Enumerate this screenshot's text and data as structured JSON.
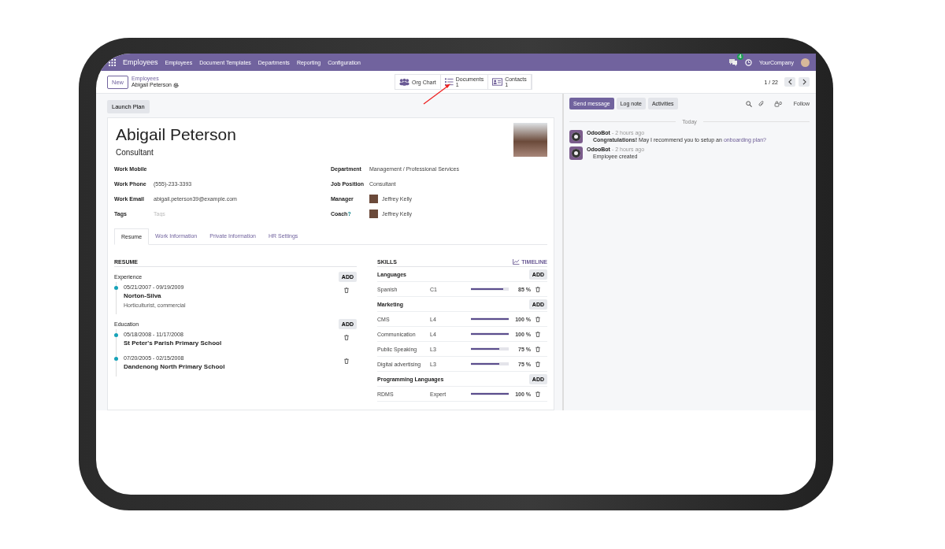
{
  "navbar": {
    "app": "Employees",
    "menu": [
      "Employees",
      "Document Templates",
      "Departments",
      "Reporting",
      "Configuration"
    ],
    "message_count": "4",
    "company": "YourCompany"
  },
  "control_panel": {
    "new": "New",
    "breadcrumb": "Employees",
    "record": "Abigail Peterson",
    "smart_buttons": [
      {
        "kind": "org",
        "label": "Org Chart"
      },
      {
        "kind": "docs",
        "label": "Documents",
        "count": "1"
      },
      {
        "kind": "contacts",
        "label": "Contacts",
        "count": "1"
      }
    ],
    "pager": "1 / 22"
  },
  "launch_plan": "Launch Plan",
  "employee": {
    "name": "Abigail Peterson",
    "job_title": "Consultant"
  },
  "left_fields": [
    {
      "label": "Work Mobile"
    },
    {
      "label": "Work Phone",
      "value": "(555)-233-3393"
    },
    {
      "label": "Work Email",
      "value": "abigail.peterson39@example.com"
    },
    {
      "label": "Tags",
      "placeholder": "Tags"
    }
  ],
  "right_fields": [
    {
      "label": "Department",
      "value": "Management / Professional Services"
    },
    {
      "label": "Job Position",
      "value": "Consultant"
    },
    {
      "label": "Manager",
      "value": "Jeffrey Kelly",
      "avatar": true
    },
    {
      "label": "Coach",
      "help": "?",
      "value": "Jeffrey Kelly",
      "avatar": true
    }
  ],
  "tabs": [
    {
      "label": "Resume",
      "selected": true
    },
    {
      "label": "Work Information",
      "selected": false
    },
    {
      "label": "Private Information",
      "selected": false
    },
    {
      "label": "HR Settings",
      "selected": false
    }
  ],
  "resume": {
    "title": "RESUME",
    "sections": [
      {
        "name": "Experience",
        "add": "ADD",
        "items": [
          {
            "dates": "05/21/2007 - 09/19/2009",
            "title": "Norton-Silva",
            "description": "Horticulturist, commercial"
          }
        ]
      },
      {
        "name": "Education",
        "add": "ADD",
        "items": [
          {
            "dates": "05/18/2008 - 11/17/2008",
            "title": "St Peter's Parish Primary School"
          },
          {
            "dates": "07/20/2005 - 02/15/2008",
            "title": "Dandenong North Primary School"
          }
        ]
      }
    ]
  },
  "skills": {
    "title": "SKILLS",
    "timeline": "TIMELINE",
    "groups": [
      {
        "name": "Languages",
        "add": "ADD",
        "items": [
          {
            "name": "Spanish",
            "level_name": "C1",
            "level": 0.85,
            "percent": "85 %"
          }
        ]
      },
      {
        "name": "Marketing",
        "add": "ADD",
        "items": [
          {
            "name": "CMS",
            "level_name": "L4",
            "level": 1,
            "percent": "100 %"
          },
          {
            "name": "Communication",
            "level_name": "L4",
            "level": 1,
            "percent": "100 %"
          },
          {
            "name": "Public Speaking",
            "level_name": "L3",
            "level": 0.75,
            "percent": "75 %"
          },
          {
            "name": "Digital advertising",
            "level_name": "L3",
            "level": 0.75,
            "percent": "75 %"
          }
        ]
      },
      {
        "name": "Programming Languages",
        "add": "ADD",
        "items": [
          {
            "name": "RDMS",
            "level_name": "Expert",
            "level": 1,
            "percent": "100 %"
          }
        ]
      }
    ]
  },
  "chatter": {
    "buttons": [
      {
        "label": "Send message",
        "selected": true
      },
      {
        "label": "Log note",
        "selected": false
      },
      {
        "label": "Activities",
        "selected": false
      }
    ],
    "followers": "0",
    "follow": "Follow",
    "date": "Today",
    "messages": [
      {
        "author": "OdooBot",
        "time": "- 2 hours ago",
        "text": "**Congratulations!** May I recommend you to setup an",
        "link": "onboarding plan?"
      },
      {
        "author": "OdooBot",
        "time": "- 2 hours ago",
        "text": "Employee created"
      }
    ]
  }
}
